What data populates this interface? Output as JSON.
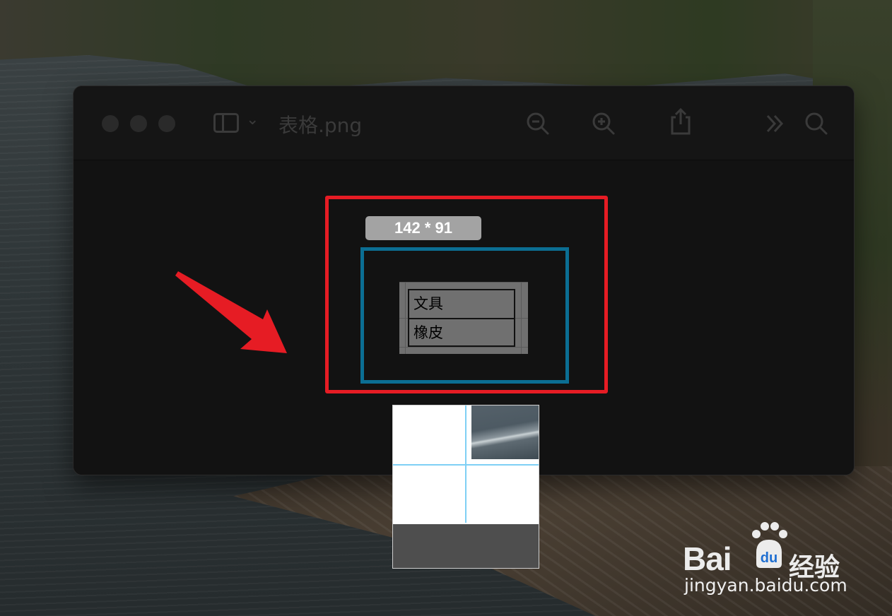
{
  "window": {
    "title": "表格.png",
    "traffic_lights": [
      "close",
      "minimize",
      "zoom"
    ],
    "toolbar_icons": [
      "sidebar-toggle-icon",
      "chevron-down-icon",
      "zoom-out-icon",
      "zoom-in-icon",
      "share-icon",
      "more-tools-icon",
      "search-icon"
    ]
  },
  "document": {
    "size_label": "142 * 91",
    "table_rows": [
      "文具",
      "橡皮"
    ]
  },
  "annotations": {
    "highlight_color": "#e61c24",
    "selection_color": "#0b6e93",
    "arrow_color": "#e61c24"
  },
  "loupe": {
    "crosshair_color": "#7fd0f5"
  },
  "watermark": {
    "logo_text": "Bai",
    "logo_suffix": "经验",
    "url": "jingyan.baidu.com"
  }
}
